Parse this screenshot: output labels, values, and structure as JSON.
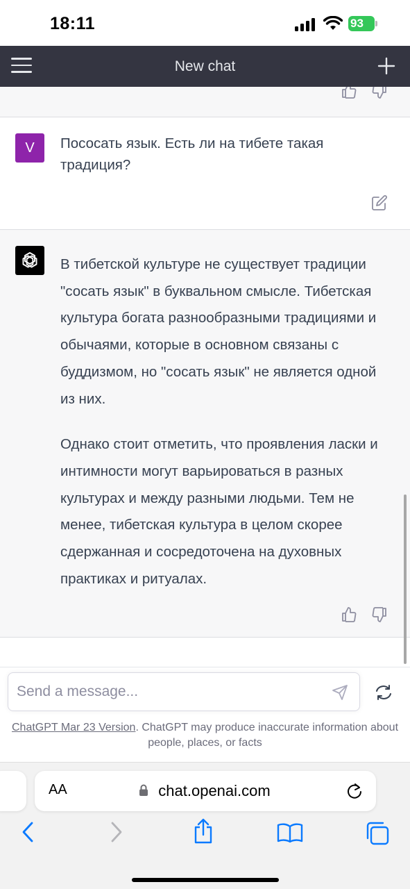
{
  "status_bar": {
    "time": "18:11",
    "battery": "93"
  },
  "header": {
    "title": "New chat"
  },
  "messages": {
    "user_avatar": "V",
    "user_text": "Пососать язык. Есть ли на тибете такая традиция?",
    "assistant_paragraphs": [
      "В тибетской культуре не существует традиции \"сосать язык\" в буквальном смысле. Тибетская культура богата разнообразными традициями и обычаями, которые в основном связаны с буддизмом, но \"сосать язык\" не является одной из них.",
      "Однако стоит отметить, что проявления ласки и интимности могут варьироваться в разных культурах и между разными людьми. Тем не менее, тибетская культура в целом скорее сдержанная и сосредоточена на духовных практиках и ритуалах."
    ]
  },
  "composer": {
    "placeholder": "Send a message...",
    "version_link": "ChatGPT Mar 23 Version",
    "disclaimer": ". ChatGPT may produce inaccurate information about people, places, or facts"
  },
  "browser": {
    "aa_label": "AA",
    "url": "chat.openai.com"
  },
  "icons": {
    "menu": "hamburger-icon",
    "new_chat": "plus-icon",
    "thumbs_up": "thumbs-up-icon",
    "thumbs_down": "thumbs-down-icon",
    "edit": "edit-icon",
    "send": "send-icon",
    "regenerate": "regenerate-icon",
    "lock": "lock-icon",
    "reload": "reload-icon",
    "back": "back-icon",
    "forward": "forward-icon",
    "share": "share-icon",
    "bookmarks": "book-icon",
    "tabs": "tabs-icon"
  },
  "colors": {
    "header_bg": "#343541",
    "assistant_bg": "#f7f7f8",
    "user_avatar_bg": "#8e24aa",
    "battery": "#34c759",
    "ios_blue": "#0a7aff"
  }
}
